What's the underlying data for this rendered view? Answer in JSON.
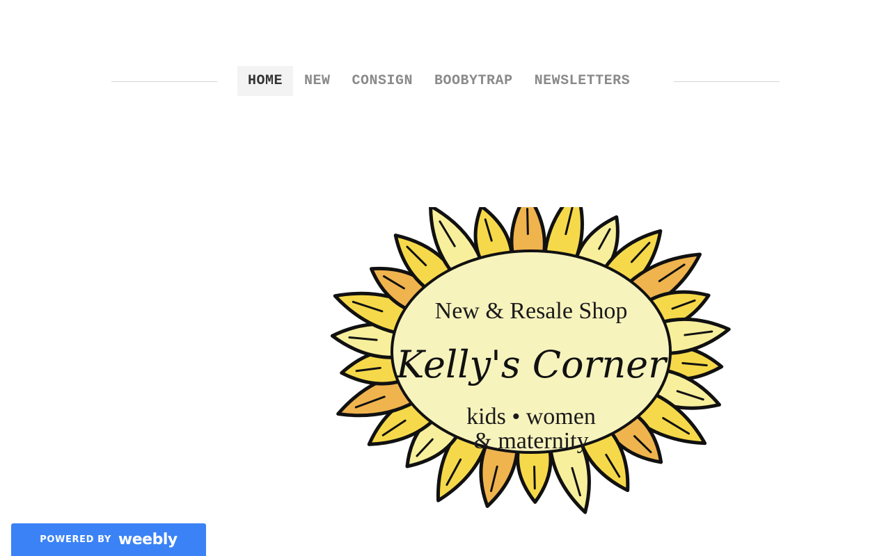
{
  "nav": {
    "items": [
      {
        "label": "HOME",
        "active": true
      },
      {
        "label": "NEW",
        "active": false
      },
      {
        "label": "CONSIGN",
        "active": false
      },
      {
        "label": "BOOBYTRAP",
        "active": false
      },
      {
        "label": "NEWSLETTERS",
        "active": false
      }
    ]
  },
  "logo": {
    "tagline": "New & Resale Shop",
    "name": "Kelly's Corner",
    "line1": "kids • women",
    "line2": "& maternity",
    "petal_color": "#f6d94a",
    "petal_light": "#f7ef9c",
    "petal_accent": "#f0b44e",
    "center_color": "#f7f3bd",
    "outline_color": "#111111"
  },
  "badge": {
    "powered_label": "POWERED BY",
    "brand_label": "weebly",
    "background": "#3b82f6"
  }
}
